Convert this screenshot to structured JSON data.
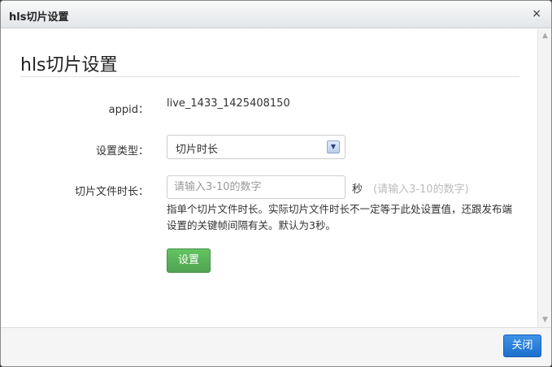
{
  "window": {
    "title": "hls切片设置",
    "close_glyph": "×"
  },
  "form": {
    "heading": "hls切片设置",
    "appid_label": "appid：",
    "appid_value": "live_1433_1425408150",
    "type_label": "设置类型：",
    "type_selected": "切片时长",
    "duration_label": "切片文件时长：",
    "duration_placeholder": "请输入3-10的数字",
    "duration_unit": "秒",
    "duration_hint": "(请输入3-10的数字)",
    "help_text": "指单个切片文件时长。实际切片文件时长不一定等于此处设置值，还跟发布端设置的关键帧间隔有关。默认为3秒。",
    "submit_label": "设置"
  },
  "footer": {
    "close_label": "关闭"
  },
  "colors": {
    "submit": "#5bb75b",
    "close": "#2a7ad6"
  }
}
